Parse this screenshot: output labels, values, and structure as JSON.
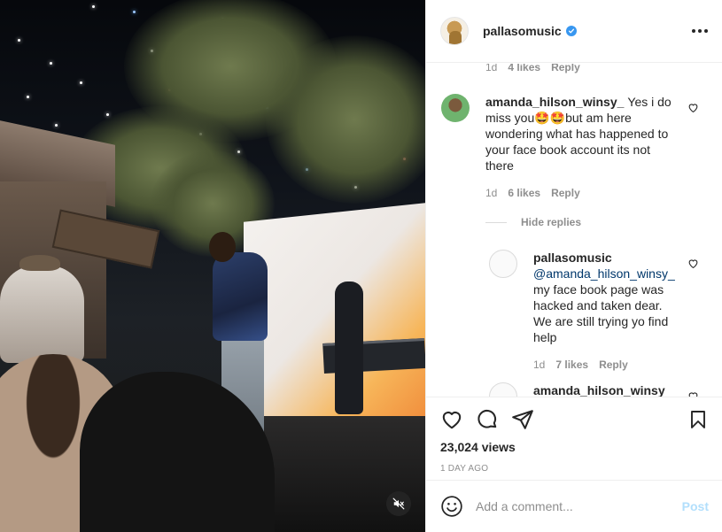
{
  "post": {
    "author": "pallasomusic",
    "verified": true
  },
  "top_meta": {
    "time": "1d",
    "likes": "4 likes",
    "reply": "Reply"
  },
  "comments": [
    {
      "user": "amanda_hilson_winsy_",
      "text": "Yes i do miss you🤩🤩but am here wondering what has happened to your face book account its not there",
      "time": "1d",
      "likes": "6 likes",
      "reply": "Reply"
    }
  ],
  "hide_replies": "Hide replies",
  "replies": [
    {
      "user": "pallasomusic",
      "mention": "@amanda_hilson_winsy_",
      "text": "my face book page was hacked and taken dear. We are still trying yo find help",
      "time": "1d",
      "likes": "7 likes",
      "reply": "Reply"
    },
    {
      "user": "amanda_hilson_winsy"
    }
  ],
  "stats": {
    "views": "23,024 views",
    "date": "1 DAY AGO"
  },
  "composer": {
    "placeholder": "Add a comment...",
    "post_label": "Post"
  },
  "colors": {
    "verified": "#3897f0",
    "post_disabled": "#b2dffc",
    "muted_text": "#8e8e8e",
    "mention": "#00376b"
  },
  "icons": [
    "more-icon",
    "heart-icon",
    "comment-icon",
    "share-icon",
    "save-icon",
    "emoji-icon",
    "mute-icon",
    "verified-icon"
  ]
}
